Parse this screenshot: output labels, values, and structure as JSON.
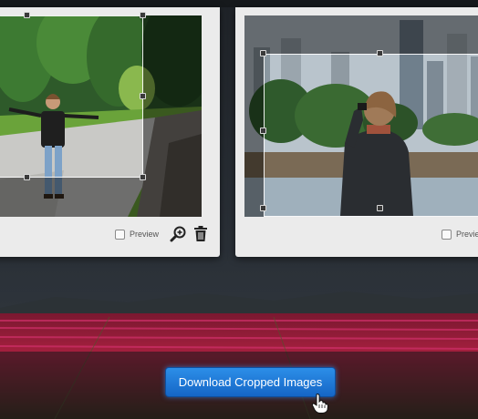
{
  "cards": [
    {
      "preview_label": "Preview"
    },
    {
      "preview_label": "Preview"
    }
  ],
  "download_button": {
    "label": "Download Cropped Images"
  },
  "colors": {
    "accent": "#1f7ad8",
    "card_bg": "#ebebeb",
    "page_bg": "#23272c"
  },
  "icons": [
    "zoom-in-icon",
    "trash-icon",
    "hand-pointer-icon"
  ]
}
